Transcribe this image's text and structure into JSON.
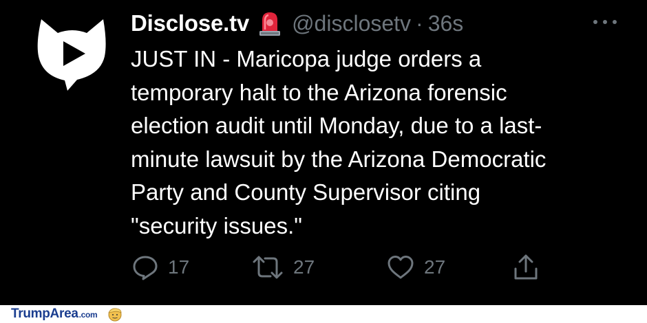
{
  "tweet": {
    "display_name": "Disclose.tv",
    "handle": "@disclosetv",
    "separator": "·",
    "time": "36s",
    "text_lines": [
      "JUST IN - Maricopa judge orders a",
      "temporary halt to the Arizona forensic",
      "election audit until Monday, due to a last-",
      "minute lawsuit by the Arizona Democratic",
      "Party and County Supervisor citing",
      "\"security issues.\""
    ],
    "badge_icon": "siren-emoji-icon",
    "more_icon": "more-horizontal-icon"
  },
  "actions": {
    "reply": {
      "icon": "reply-icon",
      "count": "17"
    },
    "retweet": {
      "icon": "retweet-icon",
      "count": "27"
    },
    "like": {
      "icon": "heart-icon",
      "count": "27"
    },
    "share": {
      "icon": "share-icon"
    }
  },
  "footer": {
    "brand": "TrumpArea",
    "brand_suffix": ".com"
  },
  "colors": {
    "background": "#000000",
    "text": "#ffffff",
    "muted": "#6e767d",
    "brand": "#1a3d8f"
  }
}
